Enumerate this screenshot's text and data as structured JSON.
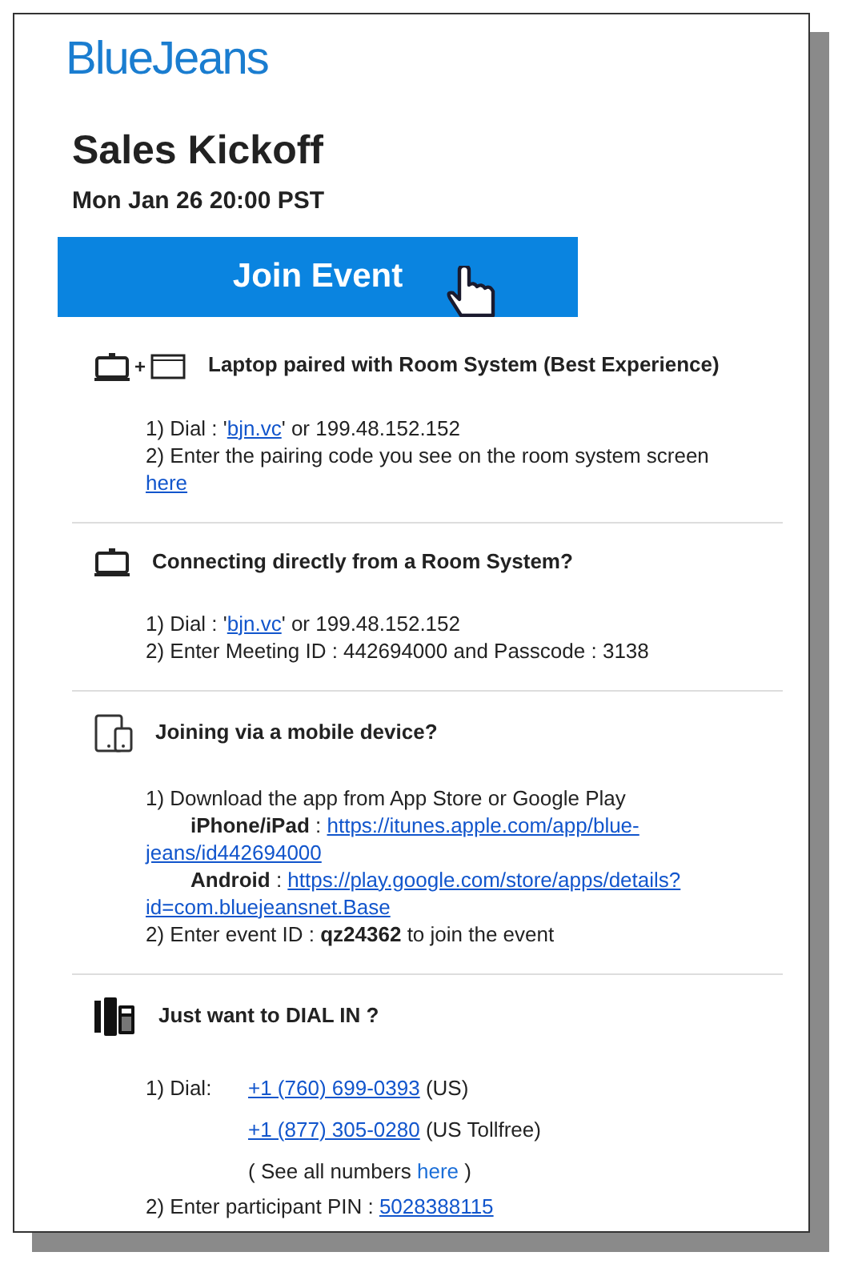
{
  "logo": "BlueJeans",
  "event": {
    "title": "Sales Kickoff",
    "datetime": "Mon Jan 26 20:00 PST"
  },
  "join_button": "Join Event",
  "sections": [
    {
      "kind": "pairing",
      "joiner": "+",
      "title": "Laptop paired with Room System (Best Experience)",
      "lines": [
        {
          "kind": "plain",
          "parts": [
            {
              "kind": "text",
              "text": "1) Dial : '"
            },
            {
              "kind": "link",
              "text": "bjn.vc"
            },
            {
              "kind": "text",
              "text": "' or 199.48.152.152"
            }
          ]
        },
        {
          "kind": "plain",
          "parts": [
            {
              "kind": "text",
              "text": "2) Enter the pairing code you see on the room system screen"
            }
          ]
        },
        {
          "kind": "plain",
          "parts": [
            {
              "kind": "link",
              "text": "here"
            }
          ]
        }
      ]
    },
    {
      "kind": "room",
      "title": "Connecting directly from a Room System?",
      "lines": [
        {
          "kind": "plain",
          "parts": [
            {
              "kind": "text",
              "text": "1) Dial : '"
            },
            {
              "kind": "link",
              "text": "bjn.vc"
            },
            {
              "kind": "text",
              "text": "' or 199.48.152.152"
            }
          ]
        },
        {
          "kind": "plain",
          "parts": [
            {
              "kind": "text",
              "text": "2) Enter Meeting ID : 442694000 and Passcode : 3138"
            }
          ]
        }
      ]
    },
    {
      "kind": "mobile",
      "title": "Joining via a mobile device?",
      "lines": [
        {
          "kind": "plain",
          "parts": [
            {
              "kind": "text",
              "text": "1) Download the app from App Store or Google Play"
            }
          ]
        },
        {
          "kind": "sub",
          "parts": [
            {
              "kind": "text",
              "text": "**iPhone/iPad** : "
            },
            {
              "kind": "link",
              "text": "https://itunes.apple.com/app/blue-"
            }
          ]
        },
        {
          "kind": "plain",
          "parts": [
            {
              "kind": "link",
              "text": "jeans/id442694000"
            }
          ]
        },
        {
          "kind": "sub",
          "parts": [
            {
              "kind": "text",
              "text": "**Android** : "
            },
            {
              "kind": "link",
              "text": "https://play.google.com/store/apps/details?"
            }
          ]
        },
        {
          "kind": "plain",
          "parts": [
            {
              "kind": "link",
              "text": "id=com.bluejeansnet.Base"
            }
          ]
        },
        {
          "kind": "plain",
          "parts": [
            {
              "kind": "text",
              "text": "2) Enter event ID : **qz24362** to join the event"
            }
          ]
        }
      ]
    },
    {
      "kind": "dialin",
      "title": "Just want to DIAL IN ?",
      "lines": [
        {
          "kind": "dial",
          "label": "1) Dial:",
          "parts": [
            {
              "kind": "link",
              "text": "+1 (760) 699-0393"
            },
            {
              "kind": "text",
              "text": " (US)"
            }
          ]
        },
        {
          "kind": "dial",
          "parts": [
            {
              "kind": "link",
              "text": "+1 (877) 305-0280"
            },
            {
              "kind": "text",
              "text": " (US Tollfree)"
            }
          ]
        },
        {
          "kind": "dial",
          "parts": [
            {
              "kind": "text",
              "text": "( See all numbers "
            },
            {
              "kind": "plainlink",
              "text": "here"
            },
            {
              "kind": "text",
              "text": " )"
            }
          ]
        },
        {
          "kind": "plain",
          "parts": [
            {
              "kind": "text",
              "text": "2) Enter participant PIN : "
            },
            {
              "kind": "link",
              "text": "5028388115"
            }
          ]
        }
      ]
    }
  ]
}
